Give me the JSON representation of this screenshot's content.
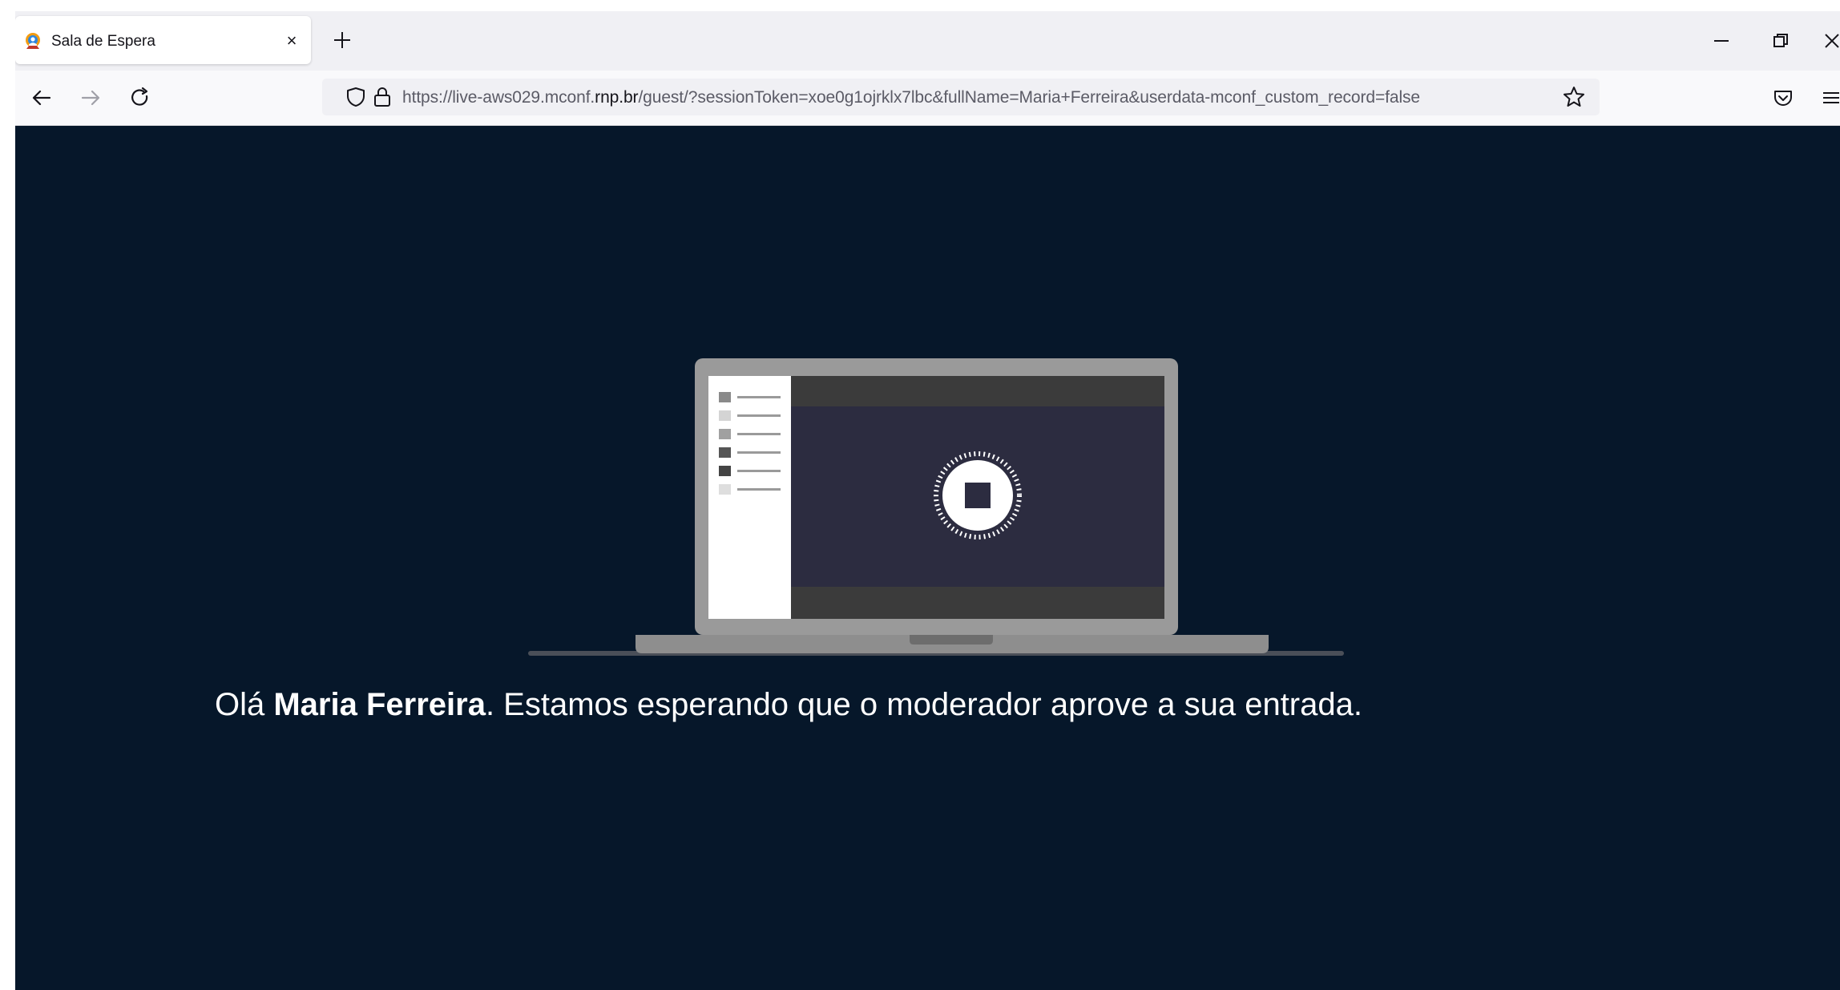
{
  "tab": {
    "title": "Sala de Espera",
    "close_symbol": "×",
    "favicon": "mconf-logo-icon"
  },
  "window": {
    "minimize_icon": "minimize-icon",
    "restore_icon": "restore-icon",
    "close_icon": "window-close-icon"
  },
  "nav": {
    "url_prefix": "https://live-aws029.mconf.",
    "url_domain": "rnp.br",
    "url_rest": "/guest/?sessionToken=xoe0g1ojrklx7lbc&fullName=Maria+Ferreira&userdata-mconf_custom_record=false"
  },
  "content": {
    "greeting_prefix": "Olá ",
    "user_name": "Maria Ferreira",
    "greeting_suffix": ". Estamos esperando que o moderador aprove a sua entrada."
  },
  "colors": {
    "page_background": "#06172a",
    "laptop_frame": "#9a9a9a",
    "laptop_screen": "#2c2c40",
    "text": "#ffffff"
  }
}
